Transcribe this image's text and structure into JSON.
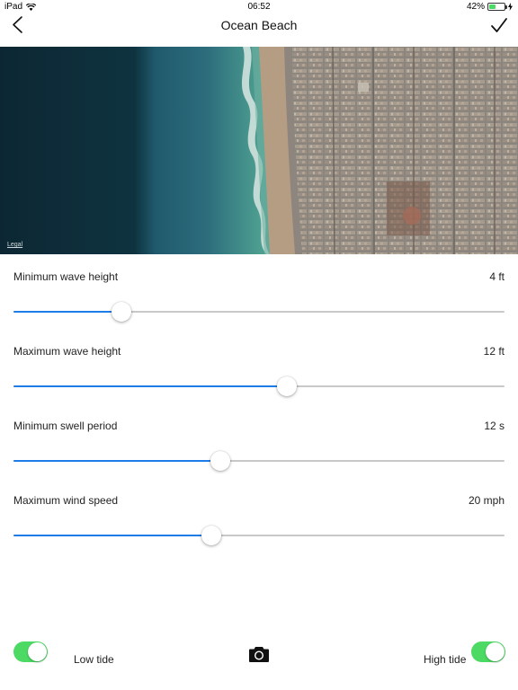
{
  "status_bar": {
    "device": "iPad",
    "time": "06:52",
    "battery": "42%",
    "battery_level": 0.42
  },
  "nav": {
    "title": "Ocean Beach",
    "back_icon": "chevron-left-icon",
    "done_icon": "checkmark-icon"
  },
  "map": {
    "legal": "Legal"
  },
  "settings": [
    {
      "label": "Minimum wave height",
      "value": "4 ft",
      "level": 0.22
    },
    {
      "label": "Maximum wave height",
      "value": "12 ft",
      "level": 0.557
    },
    {
      "label": "Minimum swell period",
      "value": "12 s",
      "level": 0.422
    },
    {
      "label": "Maximum wind speed",
      "value": "20 mph",
      "level": 0.403
    }
  ],
  "bottom": {
    "low_tide_label": "Low tide",
    "low_tide_on": true,
    "high_tide_label": "High tide",
    "high_tide_on": true,
    "camera_icon": "camera-icon"
  },
  "colors": {
    "accent": "#1e7ce8",
    "toggle_on": "#4cd964",
    "track": "#c8c8c8"
  }
}
